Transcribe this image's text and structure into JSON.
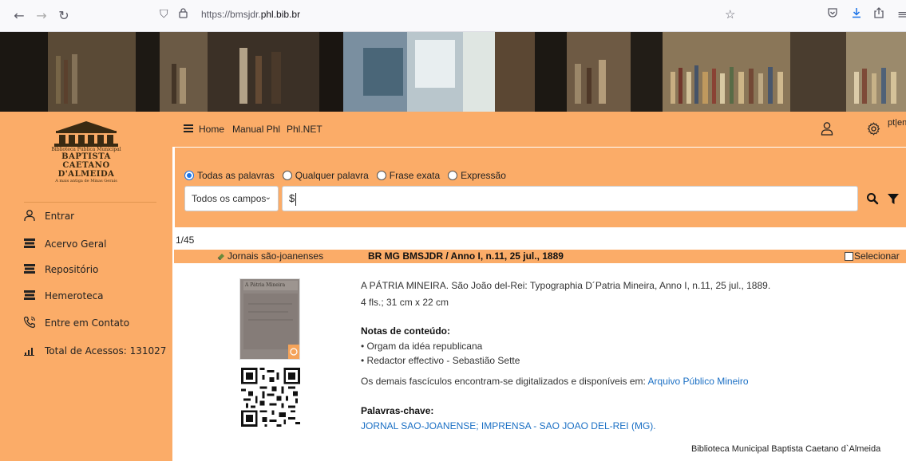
{
  "browser": {
    "url_prefix": "https://bmsjdr.",
    "url_domain": "phl.bib.br"
  },
  "sidebar": {
    "logo": {
      "line1": "Biblioteca Pública Municipal",
      "line2": "BAPTISTA CAETANO D'ALMEIDA",
      "line3": "A mais antiga de Minas Gerais"
    },
    "items": [
      {
        "label": "Entrar",
        "icon": "user-icon"
      },
      {
        "label": "Acervo Geral",
        "icon": "books-icon"
      },
      {
        "label": "Repositório",
        "icon": "books-icon"
      },
      {
        "label": "Hemeroteca",
        "icon": "books-icon"
      },
      {
        "label": "Entre em Contato",
        "icon": "phone-icon"
      },
      {
        "label": "Total de Acessos: 131027",
        "icon": "bar-chart-icon"
      }
    ]
  },
  "menu": {
    "home": "Home",
    "manual": "Manual Phl",
    "phlnet": "Phl.NET",
    "lang": "pt|en"
  },
  "search": {
    "radios": [
      {
        "label": "Todas as palavras",
        "selected": true
      },
      {
        "label": "Qualquer palavra",
        "selected": false
      },
      {
        "label": "Frase exata",
        "selected": false
      },
      {
        "label": "Expressão",
        "selected": false
      }
    ],
    "field": "Todos os campos",
    "query": "$"
  },
  "results": {
    "count": "1/45",
    "collection": "Jornais são-joanenses",
    "title": "BR MG BMSJDR / Anno I, n.11, 25 jul., 1889",
    "select_label": "Selecionar",
    "thumb_caption": "A Pátria Mineira",
    "line1": "A PÁTRIA MINEIRA. São João del-Rei: Typographia D´Patria Mineira, Anno I, n.11, 25 jul., 1889.",
    "line2": "4 fls.; 31 cm x 22 cm",
    "notes_heading": "Notas de conteúdo:",
    "notes": [
      "• Orgam da idéa republicana",
      "• Redactor effectivo - Sebastião Sette"
    ],
    "extra_text": "Os demais fascículos encontram-se digitalizados e disponíveis em: ",
    "extra_link": "Arquivo Público Mineiro",
    "keywords_heading": "Palavras-chave:",
    "keywords": "JORNAL SAO-JOANENSE; IMPRENSA - SAO JOAO DEL-REI (MG).",
    "footer": "Biblioteca Municipal Baptista Caetano d`Almeida"
  },
  "colors": {
    "accent": "#fbac68",
    "link": "#1a6fc4"
  }
}
